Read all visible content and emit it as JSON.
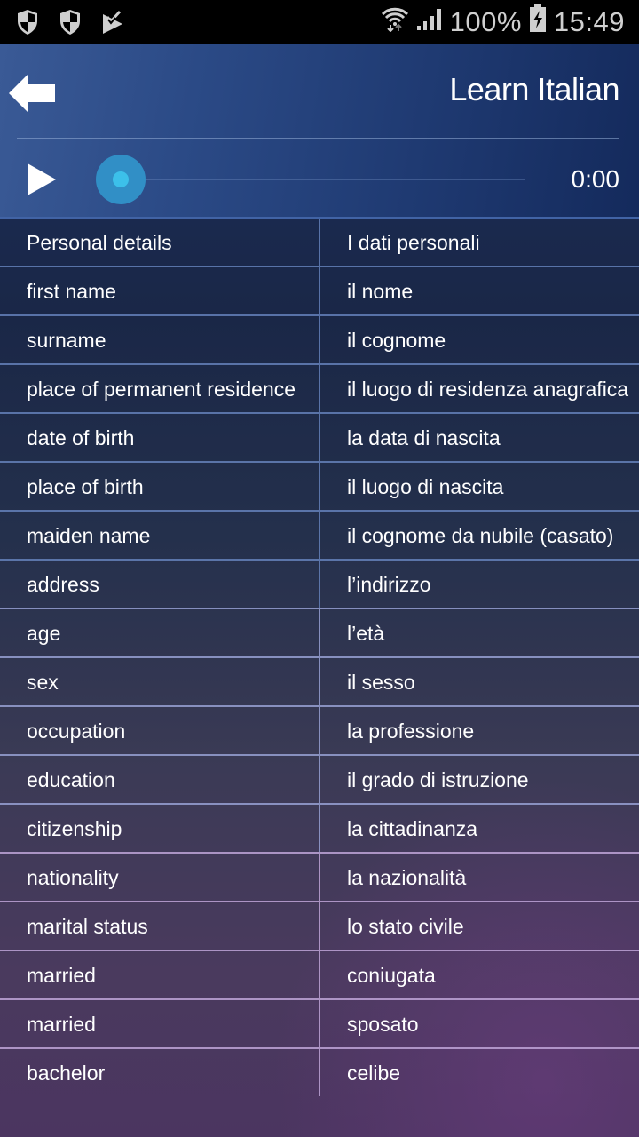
{
  "status_bar": {
    "left_icons": [
      "shield-icon",
      "shield-icon",
      "play-store-check-icon"
    ],
    "wifi_icon": "wifi-icon",
    "signal_icon": "signal-icon",
    "battery_percent": "100%",
    "battery_icon": "battery-charging-icon",
    "time": "15:49"
  },
  "header": {
    "back_icon": "back-arrow-icon",
    "title": "Learn Italian"
  },
  "player": {
    "play_icon": "play-icon",
    "progress": 0,
    "time": "0:00"
  },
  "phrases": [
    {
      "en": "Personal details",
      "it": "I dati personali"
    },
    {
      "en": "first name",
      "it": "il nome"
    },
    {
      "en": "surname",
      "it": "il cognome"
    },
    {
      "en": "place of permanent residence",
      "it": "il luogo di residenza anagrafica"
    },
    {
      "en": "date of birth",
      "it": "la data di nascita"
    },
    {
      "en": "place of birth",
      "it": "il luogo di nascita"
    },
    {
      "en": "maiden name",
      "it": "il cognome da nubile (casato)"
    },
    {
      "en": "address",
      "it": "l’indirizzo"
    },
    {
      "en": "age",
      "it": "l’età"
    },
    {
      "en": "sex",
      "it": "il sesso"
    },
    {
      "en": "occupation",
      "it": "la professione"
    },
    {
      "en": "education",
      "it": "il grado di istruzione"
    },
    {
      "en": "citizenship",
      "it": "la cittadinanza"
    },
    {
      "en": "nationality",
      "it": "la nazionalità"
    },
    {
      "en": "marital status",
      "it": "lo stato civile"
    },
    {
      "en": "married",
      "it": "coniugata"
    },
    {
      "en": "married",
      "it": "sposato"
    },
    {
      "en": "bachelor",
      "it": "celibe"
    }
  ],
  "colors": {
    "accent": "#318fc6",
    "accent_light": "#3cc0ea",
    "header_start": "#3a5a96",
    "header_end": "#142a5c"
  }
}
